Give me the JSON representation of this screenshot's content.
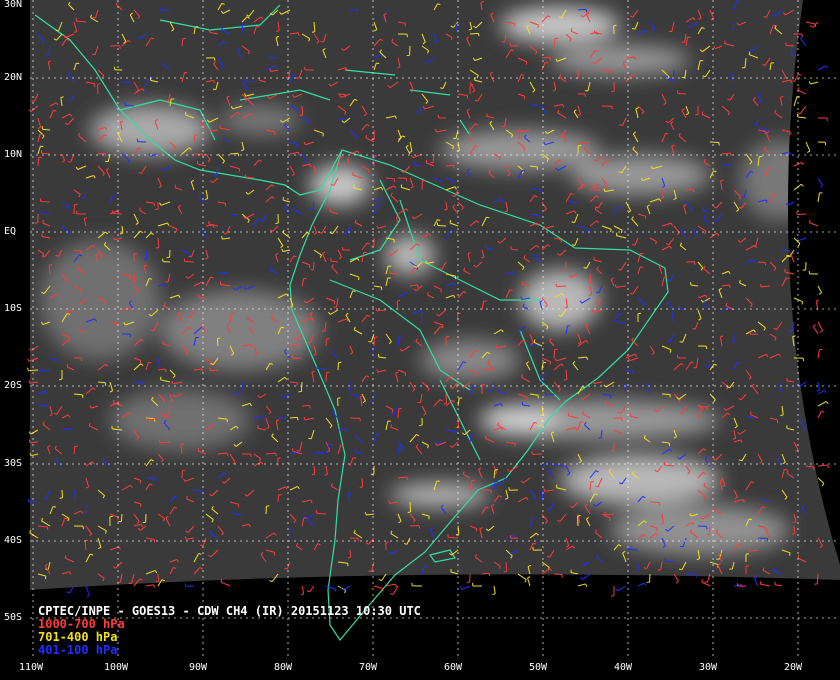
{
  "caption": {
    "title": "CPTEC/INPE - GOES13 - CDW CH4 (IR) 20151123 10:30 UTC",
    "legend": [
      {
        "label": "1000-700 hPa",
        "color": "#ff3b3b"
      },
      {
        "label": "701-400 hPa",
        "color": "#f0e020"
      },
      {
        "label": "401-100 hPa",
        "color": "#2030ff"
      }
    ]
  },
  "lat_labels": [
    "30N",
    "20N",
    "10N",
    "EQ",
    "10S",
    "20S",
    "30S",
    "40S",
    "50S"
  ],
  "lon_labels": [
    "110W",
    "100W",
    "90W",
    "80W",
    "70W",
    "60W",
    "50W",
    "40W",
    "30W",
    "20W"
  ],
  "colors": {
    "coast": "#30e0a0",
    "grid": "#ffffff",
    "background": "#000000"
  }
}
